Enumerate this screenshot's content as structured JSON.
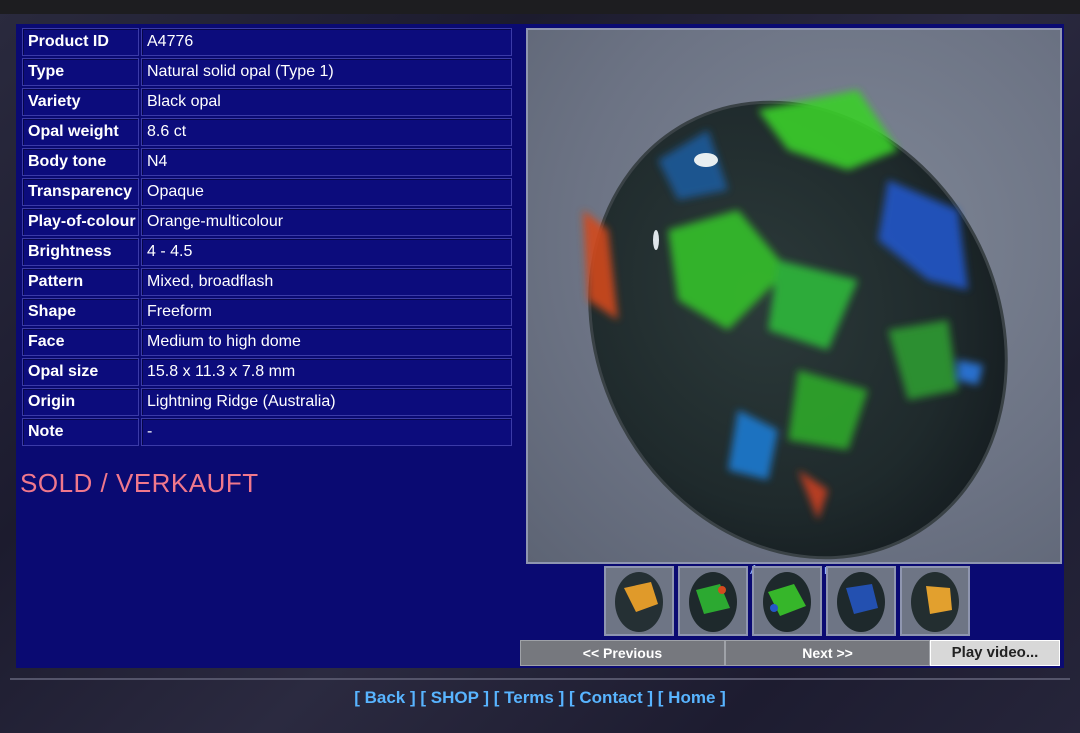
{
  "specs": [
    {
      "label": "Product ID",
      "value": "A4776"
    },
    {
      "label": "Type",
      "value": "Natural solid opal (Type 1)"
    },
    {
      "label": "Variety",
      "value": "Black opal"
    },
    {
      "label": "Opal weight",
      "value": "8.6 ct"
    },
    {
      "label": "Body tone",
      "value": "N4"
    },
    {
      "label": "Transparency",
      "value": "Opaque"
    },
    {
      "label": "Play-of-colour",
      "value": "Orange-multicolour"
    },
    {
      "label": "Brightness",
      "value": "4 - 4.5"
    },
    {
      "label": "Pattern",
      "value": "Mixed, broadflash"
    },
    {
      "label": "Shape",
      "value": "Freeform"
    },
    {
      "label": "Face",
      "value": "Medium to high dome"
    },
    {
      "label": "Opal size",
      "value": "15.8 x 11.3 x 7.8 mm"
    },
    {
      "label": "Origin",
      "value": "Lightning Ridge (Australia)"
    },
    {
      "label": "Note",
      "value": "-"
    }
  ],
  "status_text": "SOLD / VERKAUFT",
  "thumbnail_caption": "A",
  "thumbnail_caption_right": "n",
  "buttons": {
    "previous": "<< Previous",
    "next": "Next >>",
    "play_video": "Play video..."
  },
  "footer_nav": {
    "back": "[ Back ]",
    "shop": "[ SHOP ]",
    "terms": "[ Terms ]",
    "contact": "[ Contact ]",
    "home": "[ Home ]"
  },
  "colors": {
    "panel": "#0a0a72",
    "sold": "#f0788c",
    "link": "#58b4ff"
  }
}
